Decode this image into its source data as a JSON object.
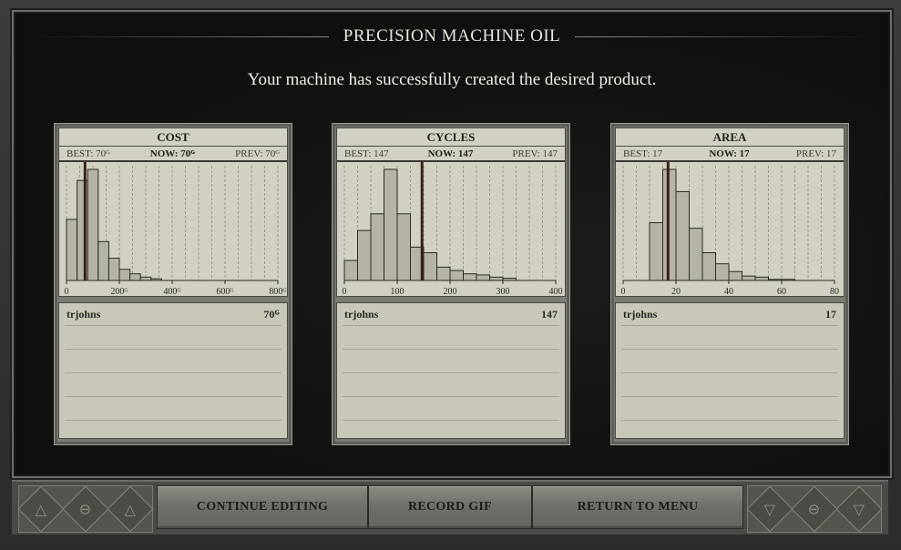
{
  "header": {
    "title": "PRECISION MACHINE OIL",
    "message": "Your machine has successfully created the desired product."
  },
  "metrics": [
    {
      "title": "COST",
      "best": "BEST: 70ᴳ",
      "now": "NOW: 70ᴳ",
      "prev": "PREV: 70ᴳ",
      "player": "trjohns",
      "score": "70ᴳ",
      "tick_labels": [
        "0",
        "200ᴳ",
        "400ᴳ",
        "600ᴳ",
        "800ᴳ"
      ]
    },
    {
      "title": "CYCLES",
      "best": "BEST: 147",
      "now": "NOW: 147",
      "prev": "PREV: 147",
      "player": "trjohns",
      "score": "147",
      "tick_labels": [
        "0",
        "100",
        "200",
        "300",
        "400"
      ]
    },
    {
      "title": "AREA",
      "best": "BEST: 17",
      "now": "NOW: 17",
      "prev": "PREV: 17",
      "player": "trjohns",
      "score": "17",
      "tick_labels": [
        "0",
        "20",
        "40",
        "60",
        "80"
      ]
    }
  ],
  "chart_data": [
    {
      "type": "bar",
      "title": "COST",
      "xlim": [
        0,
        800
      ],
      "ticks": [
        0,
        200,
        400,
        600,
        800
      ],
      "bin_width": 40,
      "bins_start": [
        0,
        40,
        80,
        120,
        160,
        200,
        240,
        280,
        320,
        360
      ],
      "values": [
        0.55,
        0.9,
        1.0,
        0.35,
        0.2,
        0.1,
        0.06,
        0.03,
        0.015,
        0
      ],
      "marker": 70
    },
    {
      "type": "bar",
      "title": "CYCLES",
      "xlim": [
        0,
        400
      ],
      "ticks": [
        0,
        100,
        200,
        300,
        400
      ],
      "bin_width": 25,
      "bins_start": [
        0,
        25,
        50,
        75,
        100,
        125,
        150,
        175,
        200,
        225,
        250,
        275,
        300,
        325
      ],
      "values": [
        0.18,
        0.45,
        0.6,
        1.0,
        0.6,
        0.3,
        0.25,
        0.12,
        0.09,
        0.06,
        0.05,
        0.03,
        0.02,
        0
      ],
      "marker": 147
    },
    {
      "type": "bar",
      "title": "AREA",
      "xlim": [
        0,
        80
      ],
      "ticks": [
        0,
        20,
        40,
        60,
        80
      ],
      "bin_width": 5,
      "bins_start": [
        0,
        5,
        10,
        15,
        20,
        25,
        30,
        35,
        40,
        45,
        50,
        55,
        60,
        65
      ],
      "values": [
        0,
        0,
        0.52,
        1.0,
        0.8,
        0.47,
        0.25,
        0.15,
        0.08,
        0.04,
        0.03,
        0.01,
        0.01,
        0
      ],
      "marker": 17
    }
  ],
  "buttons": {
    "continue": "CONTINUE EDITING",
    "record": "RECORD GIF",
    "return": "RETURN TO MENU"
  },
  "colors": {
    "panel_paper": "#d2d0c2",
    "ink": "#22211e",
    "histogram_fill": "#b5b3a6"
  }
}
